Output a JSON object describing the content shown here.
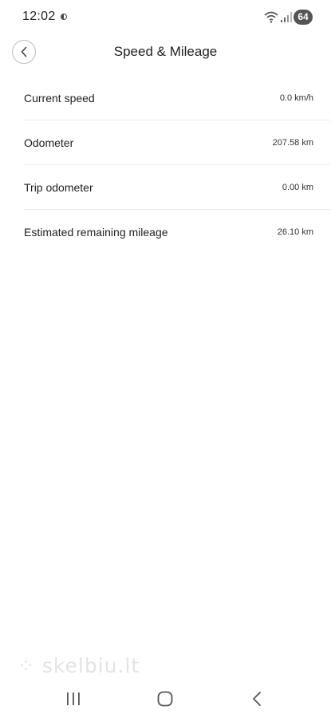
{
  "status_bar": {
    "time": "12:02",
    "battery": "64"
  },
  "header": {
    "title": "Speed & Mileage"
  },
  "rows": [
    {
      "label": "Current speed",
      "value": "0.0 km/h"
    },
    {
      "label": "Odometer",
      "value": "207.58 km"
    },
    {
      "label": "Trip odometer",
      "value": "0.00 km"
    },
    {
      "label": "Estimated remaining mileage",
      "value": "26.10 km"
    }
  ],
  "watermark": {
    "text": "skelbiu.lt"
  },
  "icons": {
    "back": "chevron-left-icon",
    "wifi": "wifi-icon",
    "signal": "signal-icon",
    "nav_recents": "recents-icon",
    "nav_home": "home-icon",
    "nav_back": "back-icon"
  }
}
